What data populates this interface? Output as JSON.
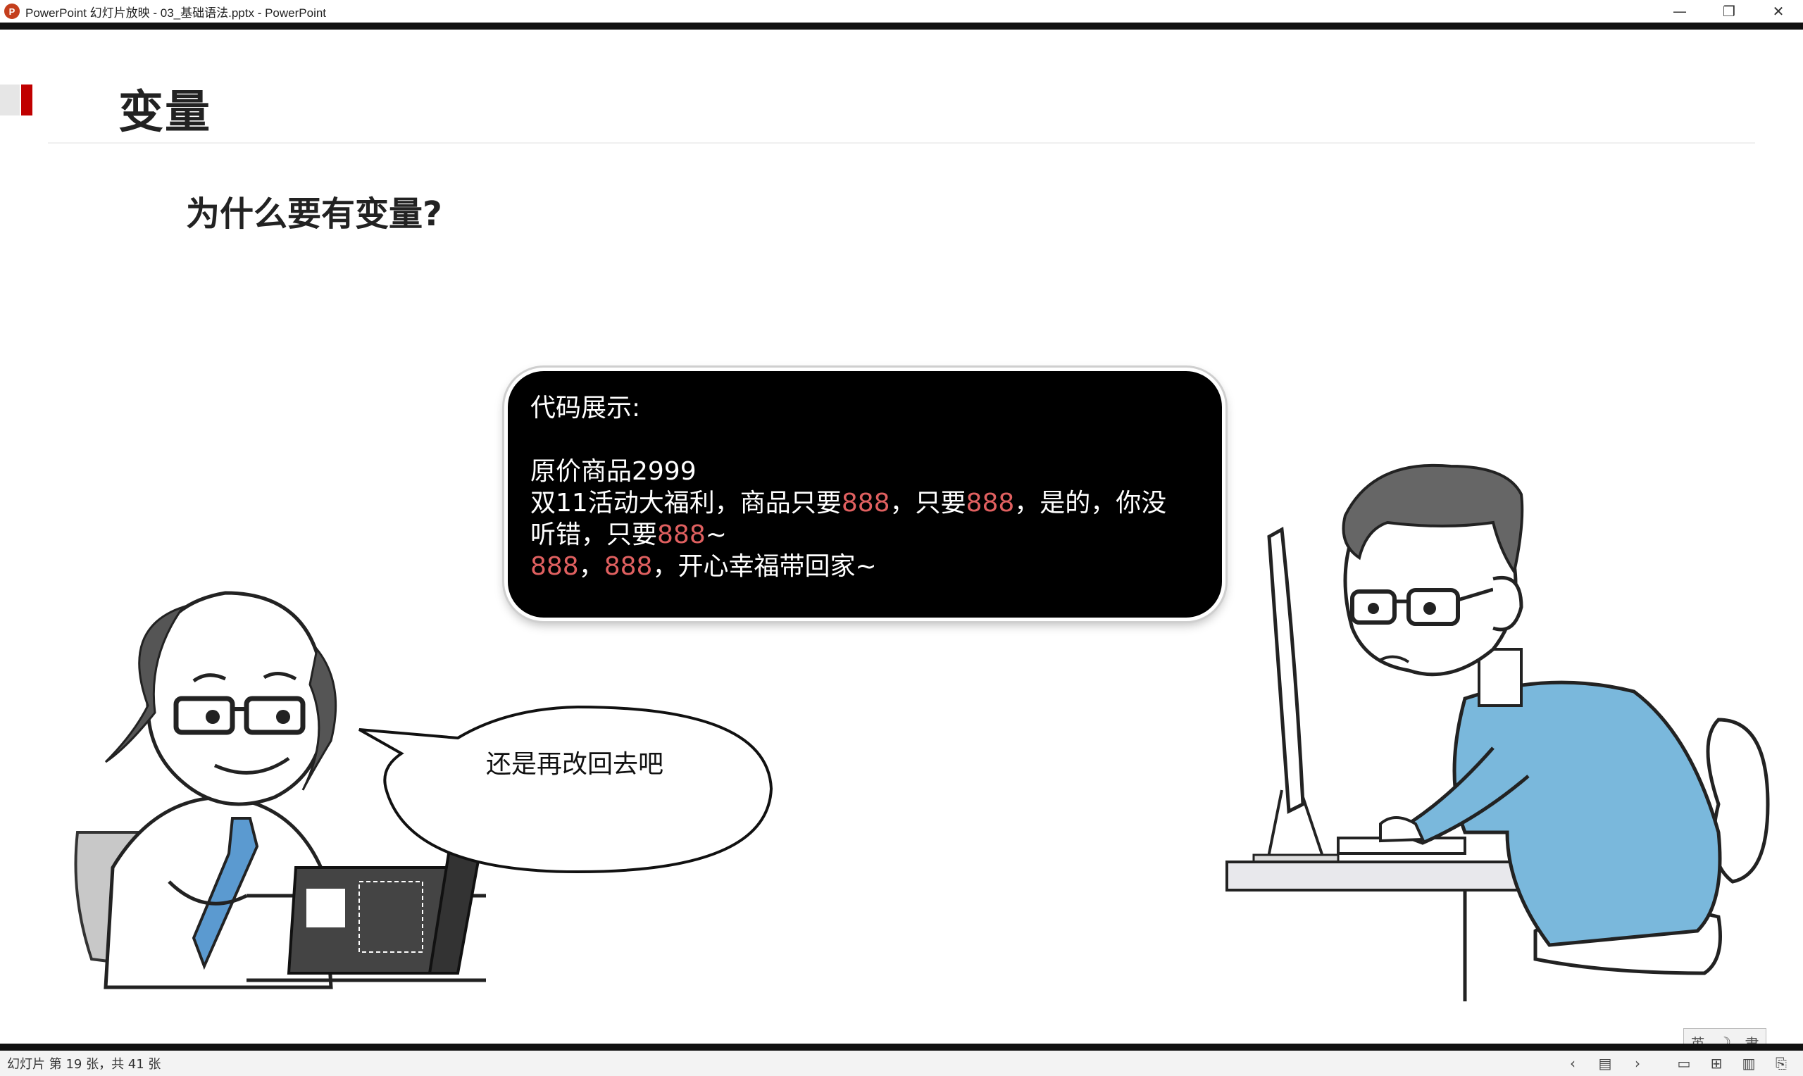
{
  "window": {
    "app_icon_letter": "P",
    "title": "PowerPoint 幻灯片放映  -  03_基础语法.pptx - PowerPoint",
    "minimize_glyph": "—",
    "restore_glyph": "❐",
    "close_glyph": "✕"
  },
  "slide": {
    "title": "变量",
    "subtitle": "为什么要有变量?",
    "code_bubble": {
      "heading": "代码展示:",
      "line1": "原价商品2999",
      "line2_a": "双11活动大福利，商品只要",
      "line2_b": "888",
      "line2_c": "，只要",
      "line2_d": "888",
      "line2_e": "，是的，你没",
      "line3_a": "听错，只要",
      "line3_b": "888",
      "line3_c": "~",
      "line4_a": "888",
      "line4_b": "，",
      "line4_c": "888",
      "line4_d": "，开心幸福带回家~"
    },
    "speech_bubble": "还是再改回去吧",
    "ime": {
      "char1": "英",
      "char2": "☽",
      "char3": "⺺"
    }
  },
  "statusbar": {
    "slide_counter": "幻灯片 第 19 张，共 41 张",
    "prev_glyph": "‹",
    "menu_glyph": "▤",
    "next_glyph": "›",
    "normal_view_glyph": "▭",
    "sorter_view_glyph": "⊞",
    "reading_view_glyph": "▥",
    "slideshow_glyph": "⎘"
  },
  "colors": {
    "accent_red": "#c00000",
    "highlight_red": "#e06060",
    "shirt_blue": "#7ab8dc",
    "tie_blue": "#5b9ad0"
  },
  "icons": {
    "app": "powerpoint-icon",
    "minimize": "minimize-icon",
    "restore": "restore-icon",
    "close": "close-icon"
  }
}
